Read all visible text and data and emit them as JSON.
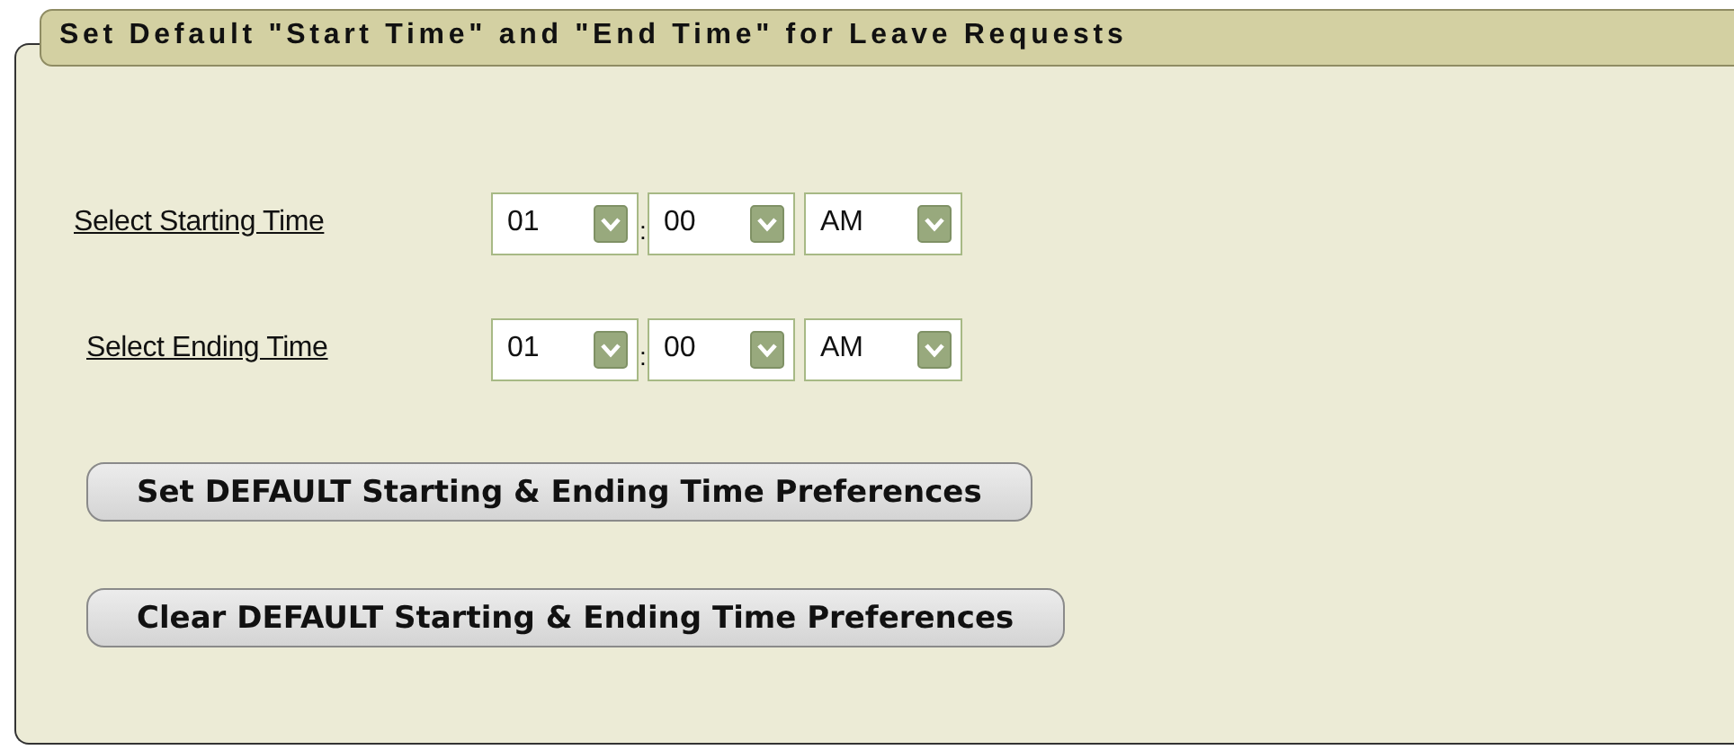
{
  "panel": {
    "title": "Set Default \"Start Time\" and \"End Time\" for Leave Requests"
  },
  "time_rows": [
    {
      "label": "Select Starting Time",
      "hour": "01",
      "separator": ":",
      "minute": "00",
      "meridiem": "AM"
    },
    {
      "label": "Select Ending Time",
      "hour": "01",
      "separator": ":",
      "minute": "00",
      "meridiem": "AM"
    }
  ],
  "buttons": [
    {
      "label": "Set DEFAULT Starting & Ending Time Preferences"
    },
    {
      "label": "Clear DEFAULT Starting & Ending Time Preferences"
    }
  ]
}
